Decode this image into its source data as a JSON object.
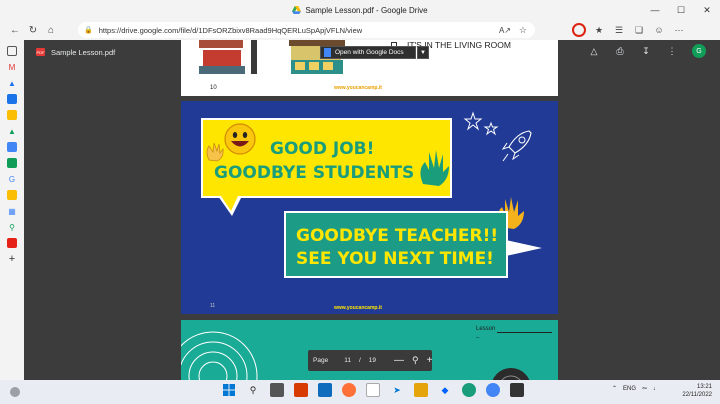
{
  "window": {
    "title": "Sample Lesson.pdf - Google Drive",
    "controls": {
      "minimize": "—",
      "maximize": "☐",
      "close": "✕"
    }
  },
  "addressbar": {
    "url": "https://drive.google.com/file/d/1DFsORZbixv8Raad9HqQERLuSpApjVFLN/view",
    "read_aloud": "A↗"
  },
  "viewer": {
    "file_name": "Sample Lesson.pdf",
    "pdf_badge": "PDF",
    "open_with": "Open with Google Docs",
    "avatar_initial": "G"
  },
  "page10": {
    "text": "IT'S IN THE LIVING ROOM",
    "number": "10",
    "site": "www.youcancamp.it"
  },
  "page11": {
    "line1": "GOOD JOB!",
    "line2": "GOODBYE STUDENTS",
    "line3": "GOODBYE TEACHER!!",
    "line4": "SEE YOU NEXT TIME!",
    "number": "11",
    "site": "www.youcancamp.it"
  },
  "page12": {
    "lesson_label": "Lesson",
    "dash": "–"
  },
  "page_control": {
    "label": "Page",
    "current": "11",
    "separator": "/",
    "total": "19",
    "zoom_out": "—",
    "zoom_in": "+"
  },
  "taskbar": {
    "lang": "ENG",
    "time": "13:21",
    "date": "22/11/2022"
  },
  "colors": {
    "slide_blue": "#203a96",
    "bubble_yellow": "#ffe600",
    "bubble_teal": "#1c9c86",
    "text_teal": "#1a9d7a"
  }
}
